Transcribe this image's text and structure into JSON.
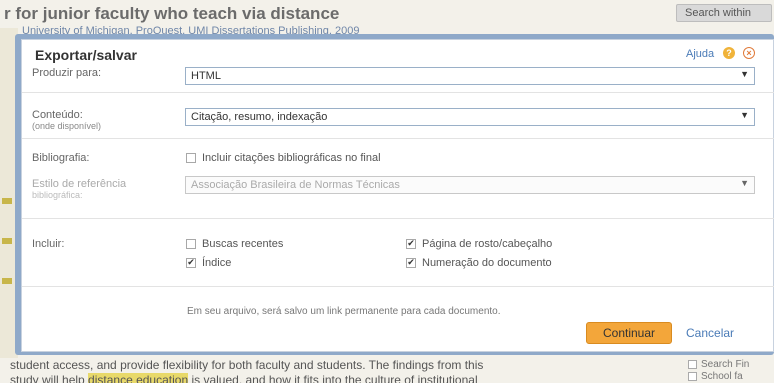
{
  "background": {
    "title": "r for junior faculty who teach via distance",
    "top_button": "Search within",
    "subtitle": "University of Michigan, ProQuest, UMI Dissertations Publishing, 2009",
    "bottom_line_1": "student access, and provide flexibility for both faculty and students. The findings from this",
    "bottom_line_2_pre": "study will help ",
    "bottom_line_2_highlight": "distance education",
    "bottom_line_2_post": " is valued, and how it fits into the culture of institutional",
    "right_panel": [
      "Search Fin",
      "School fa"
    ]
  },
  "modal": {
    "title": "Exportar/salvar",
    "help_label": "Ajuda",
    "help_icon": "?",
    "close_icon": "×",
    "produce_for": {
      "label": "Produzir para:",
      "value": "HTML"
    },
    "content": {
      "label": "Conteúdo:",
      "sublabel": "(onde disponível)",
      "value": "Citação, resumo, indexação"
    },
    "bibliography": {
      "label": "Bibliografia:",
      "checkbox_label": "Incluir citações bibliográficas no final",
      "checked": false
    },
    "citation_style": {
      "label": "Estilo de referência",
      "sublabel": "bibliográfica:",
      "value": "Associação Brasileira de Normas Técnicas"
    },
    "include": {
      "label": "Incluir:",
      "options": [
        {
          "label": "Buscas recentes",
          "checked": false
        },
        {
          "label": "Índice",
          "checked": true
        },
        {
          "label": "Página de rosto/cabeçalho",
          "checked": true
        },
        {
          "label": "Numeração do documento",
          "checked": true
        }
      ]
    },
    "note": "Em seu arquivo, será salvo um link permanente para cada documento.",
    "continue_button": "Continuar",
    "cancel_button": "Cancelar"
  },
  "colors": {
    "frame": "#8fa9c9",
    "primary_button": "#f3a63a",
    "link": "#4a7bb7"
  }
}
